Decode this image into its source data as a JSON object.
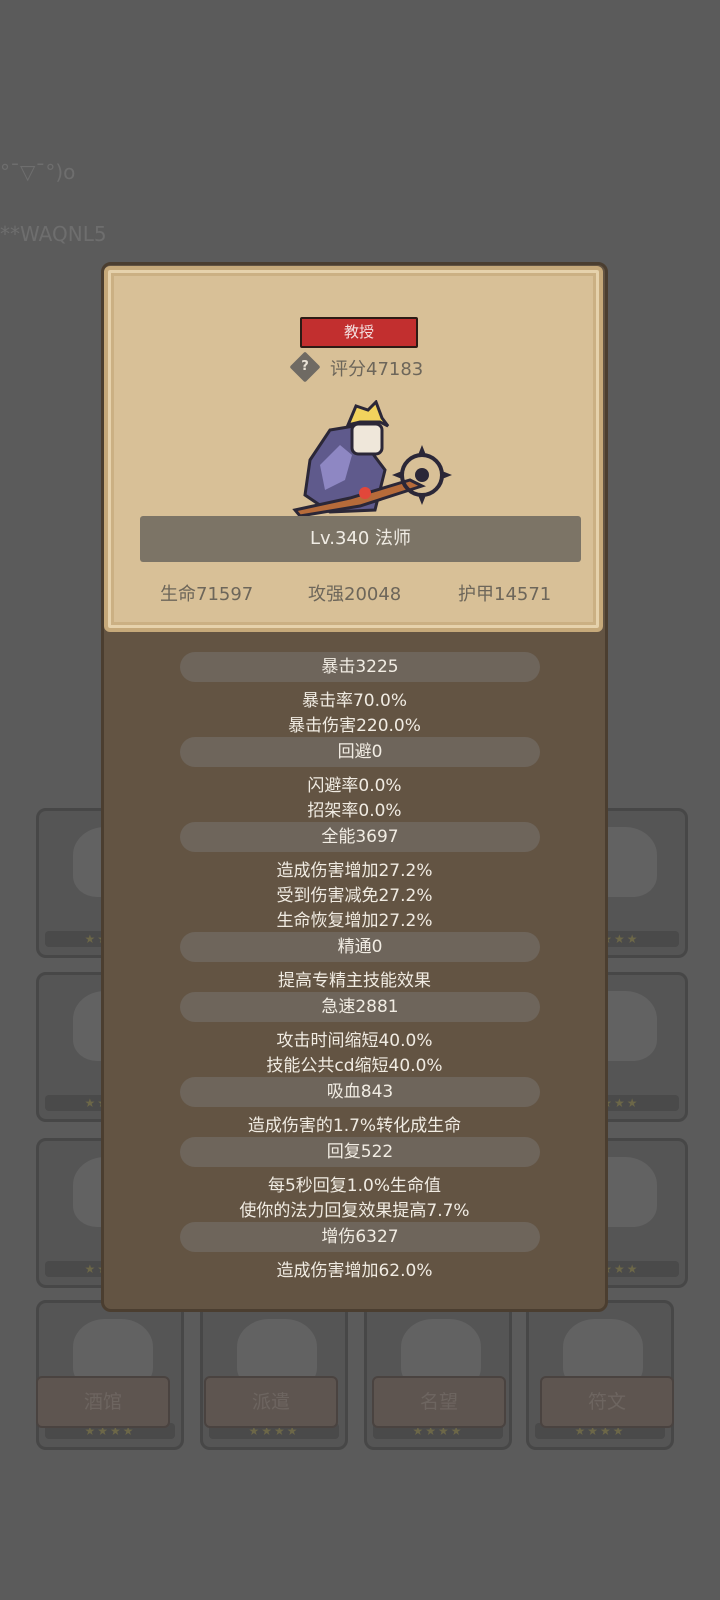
{
  "background": {
    "texts": [
      "°¯▽¯°)o",
      "**WAQNL5"
    ],
    "buttons": [
      "酒馆",
      "派遣",
      "名望",
      "符文"
    ],
    "stars": "★★★★"
  },
  "card": {
    "rank": "教授",
    "help_glyph": "?",
    "score": "评分47183",
    "level": "Lv.340 法师",
    "stats": {
      "hp": "生命71597",
      "attack": "攻强20048",
      "armor": "护甲14571"
    }
  },
  "attributes": [
    {
      "title": "暴击3225",
      "lines": [
        "暴击率70.0%",
        "暴击伤害220.0%"
      ]
    },
    {
      "title": "回避0",
      "lines": [
        "闪避率0.0%",
        "招架率0.0%"
      ]
    },
    {
      "title": "全能3697",
      "lines": [
        "造成伤害增加27.2%",
        "受到伤害减免27.2%",
        "生命恢复增加27.2%"
      ]
    },
    {
      "title": "精通0",
      "lines": [
        "提高专精主技能效果"
      ]
    },
    {
      "title": "急速2881",
      "lines": [
        "攻击时间缩短40.0%",
        "技能公共cd缩短40.0%"
      ]
    },
    {
      "title": "吸血843",
      "lines": [
        "造成伤害的1.7%转化成生命"
      ]
    },
    {
      "title": "回复522",
      "lines": [
        "每5秒回复1.0%生命值",
        "使你的法力回复效果提高7.7%"
      ]
    },
    {
      "title": "增伤6327",
      "lines": [
        "造成伤害增加62.0%"
      ]
    }
  ],
  "colors": {
    "rank_badge": "#c22f2f",
    "parchment": "#d8c097",
    "modal_body": "#635443"
  }
}
